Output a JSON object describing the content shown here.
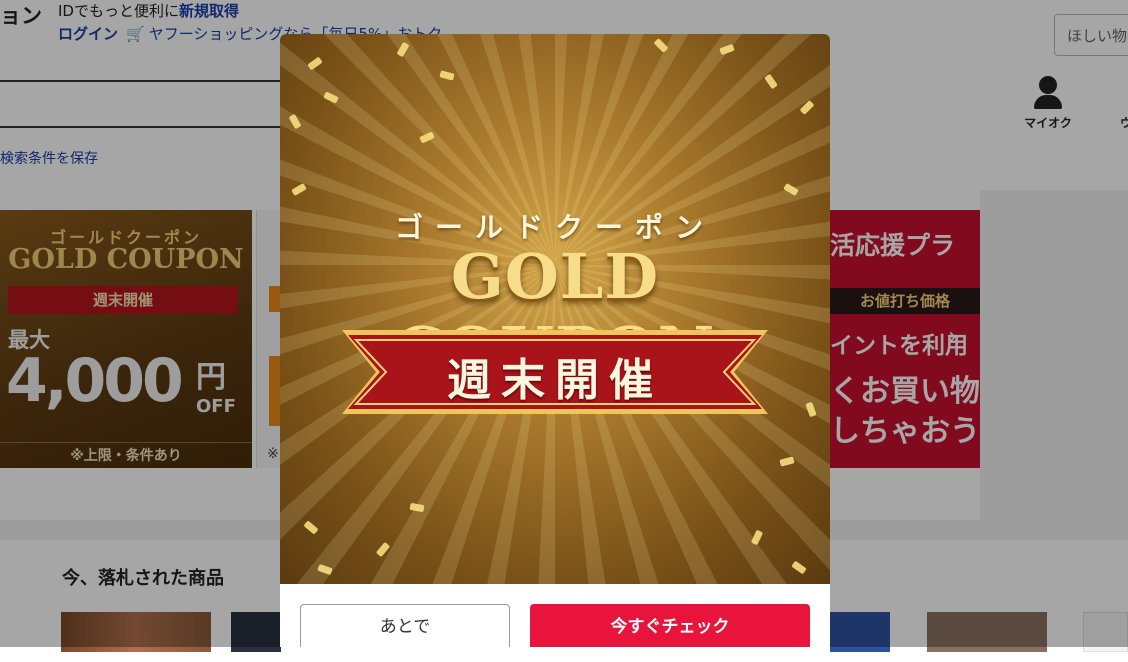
{
  "header": {
    "logo_fragment": "ョン",
    "promo_line1_prefix": "IDでもっと便利に",
    "promo_line1_link": "新規取得",
    "login_link": "ログイン",
    "shopping_promo": "ヤフーショッピングなら「毎日5%」おトク",
    "search_placeholder": "ほしい物",
    "save_conditions": "検索条件を保存",
    "myauc_label": "マイオク",
    "watch_fragment": "ウ"
  },
  "banners": {
    "gold": {
      "kana": "ゴールドクーポン",
      "title": "GOLD COUPON",
      "ribbon": "週末開催",
      "max_label": "最大",
      "amount": "4,000",
      "yen": "円",
      "off": "OFF",
      "note": "※上限・条件あり"
    },
    "mid": {
      "note": "※"
    },
    "red": {
      "title": "活応援プラ",
      "price_tag": "お値打ち価格",
      "line1": "イントを利用",
      "line2": "くお買い物",
      "line3": "しちゃおう"
    }
  },
  "sold_section": {
    "title": "今、落札された商品"
  },
  "modal": {
    "kana": "ゴールドクーポン",
    "title": "GOLD COUPON",
    "ribbon": "週末開催",
    "later_button": "あとで",
    "check_button": "今すぐチェック"
  },
  "colors": {
    "link_blue": "#1a3fa8",
    "accent_red": "#e8143c",
    "gold": "#f7dd8a"
  }
}
